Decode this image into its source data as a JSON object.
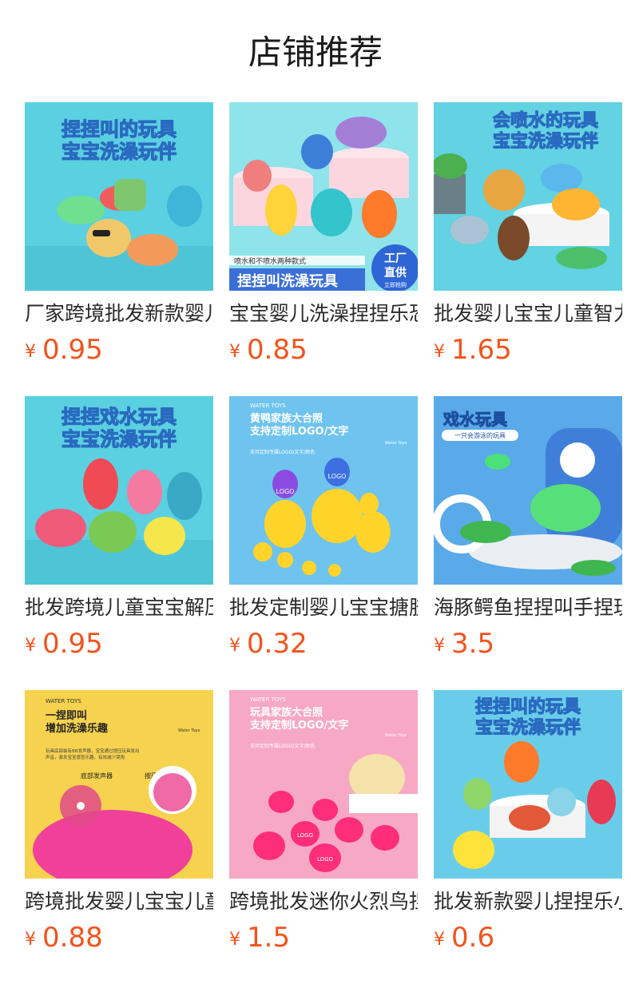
{
  "page": {
    "title": "店铺推荐",
    "currency_symbol": "¥"
  },
  "products": [
    {
      "name": "厂家跨境批发新款婴儿",
      "price": "0.95",
      "image": {
        "banner_line1": "捏捏叫的玩具",
        "banner_line2": "宝宝洗澡玩伴",
        "bg": "#5bd0e0",
        "theme": "dinosaur toys"
      }
    },
    {
      "name": "宝宝婴儿洗澡捏捏乐恐",
      "price": "0.85",
      "image": {
        "caption_small": "喷水和不喷水两种款式",
        "caption_main": "捏捏叫洗澡玩具",
        "badge_line1": "工厂",
        "badge_line2": "直供",
        "badge_line3": "立即抢购",
        "bg": "#8fe3ea",
        "theme": "dinosaur toys"
      }
    },
    {
      "name": "批发婴儿宝宝儿童智力",
      "price": "1.65",
      "image": {
        "banner_line1": "会喷水的玩具",
        "banner_line2": "宝宝洗澡玩伴",
        "bg": "#63d2e2",
        "theme": "animal toys"
      }
    },
    {
      "name": "批发跨境儿童宝宝解压",
      "price": "0.95",
      "image": {
        "banner_line1": "捏捏戏水玩具",
        "banner_line2": "宝宝洗澡玩伴",
        "bg": "#5bd0e0",
        "theme": "dinosaur toys"
      }
    },
    {
      "name": "批发定制婴儿宝宝搪胶",
      "price": "0.32",
      "image": {
        "top_label": "WATER TOYS",
        "headline1": "黄鸭家族大合照",
        "headline2": "支持定制LOGO/文字",
        "side_label": "Water Toys",
        "subline": "支持定制专属LOGO/文字/颜色",
        "logo_text": "LOGO",
        "bg": "#6ec3ef",
        "theme": "yellow ducks"
      }
    },
    {
      "name": "海豚鳄鱼捏捏叫手捏玩",
      "price": "3.5",
      "image": {
        "banner_line1": "戏水玩具",
        "banner_line2": "一只会游泳的玩具",
        "bg": "#5aa9e8",
        "theme": "dolphin and crocodile toys"
      }
    },
    {
      "name": "跨境批发婴儿宝宝儿童",
      "price": "0.88",
      "image": {
        "top_label": "WATER TOYS",
        "headline1": "一捏即叫",
        "headline2": "增加洗澡乐趣",
        "side_label": "Water Toys",
        "desc1": "玩具底部装有BB发声器，宝宝通过捏压玩具发出",
        "desc2": "声音，激发宝宝感官乐趣，有效减少哭闹",
        "label_left": "底部发声器",
        "label_right": "按压出声",
        "bg": "#f6d24e",
        "theme": "pink squeeze toy"
      }
    },
    {
      "name": "跨境批发迷你火烈鸟捏",
      "price": "1.5",
      "image": {
        "top_label": "WATER TOYS",
        "headline1": "玩具家族大合照",
        "headline2": "支持定制LOGO/文字",
        "side_label": "Water Toys",
        "subline": "支持定制专属LOGO/文字/颜色",
        "logo_text": "LOGO",
        "bg": "#f7a8c4",
        "theme": "pink flamingo ducks"
      }
    },
    {
      "name": "批发新款婴儿捏捏乐小",
      "price": "0.6",
      "image": {
        "banner_line1": "捏捏叫的玩具",
        "banner_line2": "宝宝洗澡玩伴",
        "bg": "#69cdea",
        "theme": "sea animal toys"
      }
    }
  ],
  "colors": {
    "price": "#f2531d",
    "title": "#1a1a1a",
    "name": "#2a2a2a"
  }
}
